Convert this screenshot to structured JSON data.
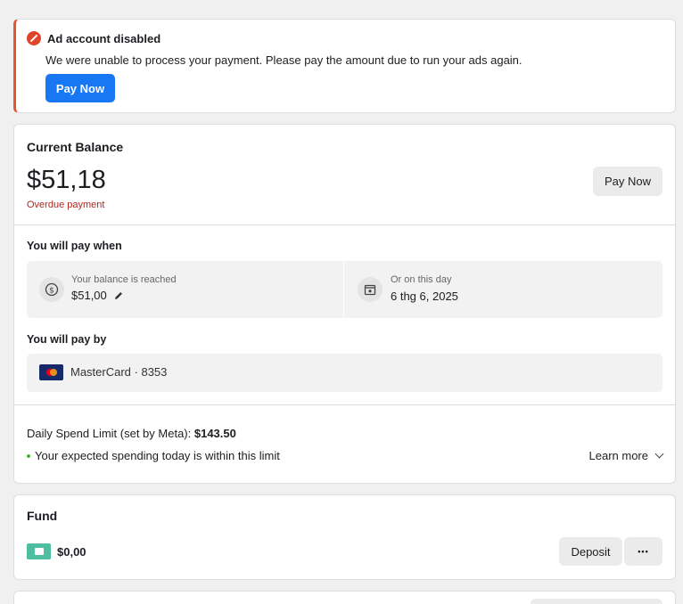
{
  "alert": {
    "title": "Ad account disabled",
    "message": "We were unable to process your payment. Please pay the amount due to run your ads again.",
    "button": "Pay Now"
  },
  "balance": {
    "title": "Current Balance",
    "amount": "$51,18",
    "status": "Overdue payment",
    "button": "Pay Now",
    "pay_when": {
      "title": "You will pay when",
      "threshold_label": "Your balance is reached",
      "threshold_value": "$51,00",
      "date_label": "Or on this day",
      "date_value": "6 thg 6, 2025"
    },
    "pay_by": {
      "title": "You will pay by",
      "method": "MasterCard · 8353"
    },
    "limit": {
      "label": "Daily Spend Limit (set by Meta):",
      "value": "$143.50",
      "status": "Your expected spending today is within this limit",
      "learn_more": "Learn more"
    }
  },
  "fund": {
    "title": "Fund",
    "amount": "$0,00",
    "deposit": "Deposit",
    "more": "•••"
  },
  "colors": {
    "primary": "#1877f2",
    "alert": "#e4572e",
    "overdue": "#b3261e",
    "ok": "#42b72a",
    "wallet": "#4fbea0"
  }
}
